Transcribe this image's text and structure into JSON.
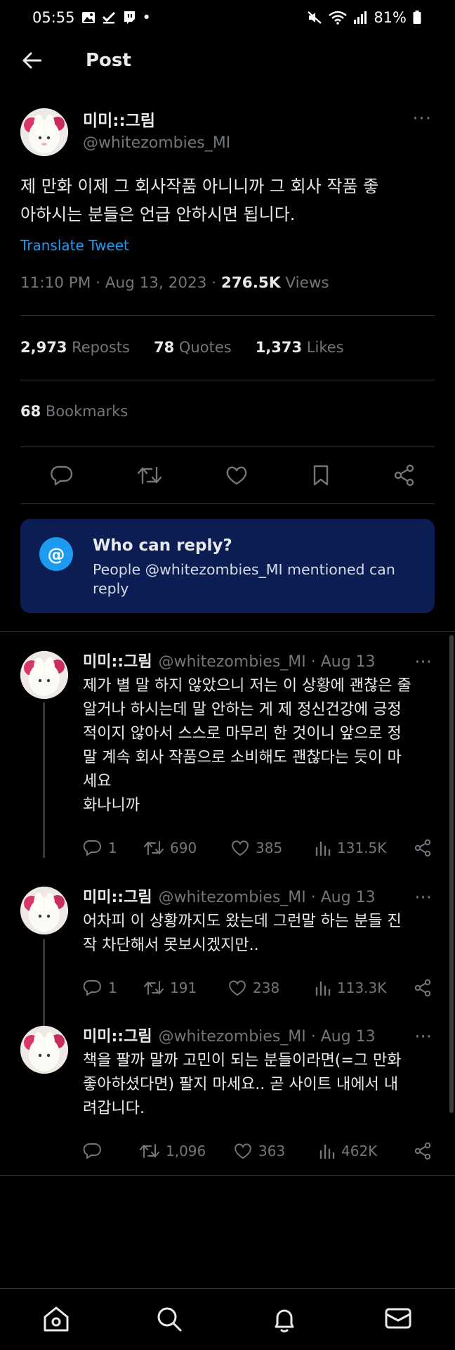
{
  "status_bar": {
    "time": "05:55",
    "dot": "•",
    "battery": "81%"
  },
  "header": {
    "title": "Post"
  },
  "tweet": {
    "display_name": "미미::그림",
    "handle": "@whitezombies_MI",
    "more": "···",
    "text_line1": "제 만화 이제 그 회사작품 아니니까 그 회사 작품 좋",
    "text_line2": "아하시는 분들은 언급 안하시면 됩니다.",
    "translate": "Translate Tweet",
    "time_date": "11:10 PM · Aug 13, 2023 · ",
    "views_count": "276.5K",
    "views_label": " Views",
    "reposts_count": "2,973",
    "reposts_label": " Reposts",
    "quotes_count": "78",
    "quotes_label": " Quotes",
    "likes_count": "1,373",
    "likes_label": " Likes",
    "bookmarks_count": "68",
    "bookmarks_label": " Bookmarks"
  },
  "who_can_reply": {
    "icon": "@",
    "title": "Who can reply?",
    "subtitle": "People @whitezombies_MI mentioned can reply"
  },
  "replies": [
    {
      "name": "미미::그림",
      "meta": "@whitezombies_MI · Aug 13",
      "more": "···",
      "lines": [
        "제가 별 말 하지 않았으니 저는 이 상황에 괜찮은 줄",
        "알거나 하시는데 말 안하는 게 제 정신건강에 긍정",
        "적이지 않아서 스스로 마무리 한 것이니 앞으로 정",
        "말 계속 회사 작품으로 소비해도 괜찮다는 듯이 마",
        "세요",
        "화나니까"
      ],
      "replies": "1",
      "reposts": "690",
      "likes": "385",
      "views": "131.5K"
    },
    {
      "name": "미미::그림",
      "meta": "@whitezombies_MI · Aug 13",
      "more": "···",
      "lines": [
        "어차피 이 상황까지도 왔는데 그런말 하는 분들 진",
        "작 차단해서 못보시겠지만.."
      ],
      "replies": "1",
      "reposts": "191",
      "likes": "238",
      "views": "113.3K"
    },
    {
      "name": "미미::그림",
      "meta": "@whitezombies_MI · Aug 13",
      "more": "···",
      "lines": [
        "책을 팔까 말까 고민이 되는 분들이라면(=그 만화",
        "좋아하셨다면) 팔지 마세요.. 곧 사이트 내에서 내",
        "려갑니다."
      ],
      "replies": "",
      "reposts": "1,096",
      "likes": "363",
      "views": "462K"
    }
  ]
}
